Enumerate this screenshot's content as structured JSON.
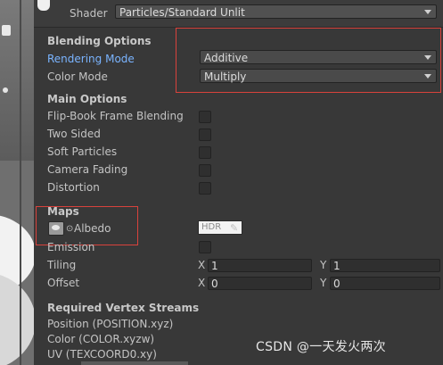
{
  "shader": {
    "label": "Shader",
    "value": "Particles/Standard Unlit"
  },
  "blending": {
    "heading": "Blending Options",
    "rendering_mode": {
      "label": "Rendering Mode",
      "value": "Additive"
    },
    "color_mode": {
      "label": "Color Mode",
      "value": "Multiply"
    }
  },
  "main": {
    "heading": "Main Options",
    "items": [
      {
        "label": "Flip-Book Frame Blending",
        "checked": false
      },
      {
        "label": "Two Sided",
        "checked": false
      },
      {
        "label": "Soft Particles",
        "checked": false
      },
      {
        "label": "Camera Fading",
        "checked": false
      },
      {
        "label": "Distortion",
        "checked": false
      }
    ]
  },
  "maps": {
    "heading": "Maps",
    "albedo_label": "Albedo",
    "hdr_label": "HDR",
    "emission_label": "Emission",
    "tiling": {
      "label": "Tiling",
      "x_axis": "X",
      "x": "1",
      "y_axis": "Y",
      "y": "1"
    },
    "offset": {
      "label": "Offset",
      "x_axis": "X",
      "x": "0",
      "y_axis": "Y",
      "y": "0"
    }
  },
  "streams": {
    "heading": "Required Vertex Streams",
    "items": [
      "Position (POSITION.xyz)",
      "Color (COLOR.xyzw)",
      "UV (TEXCOORD0.xy)"
    ]
  },
  "watermark": "CSDN @一天发火两次",
  "colors": {
    "highlight_box": "#d9423c",
    "link": "#7ab4ff",
    "panel_bg": "#383838"
  }
}
